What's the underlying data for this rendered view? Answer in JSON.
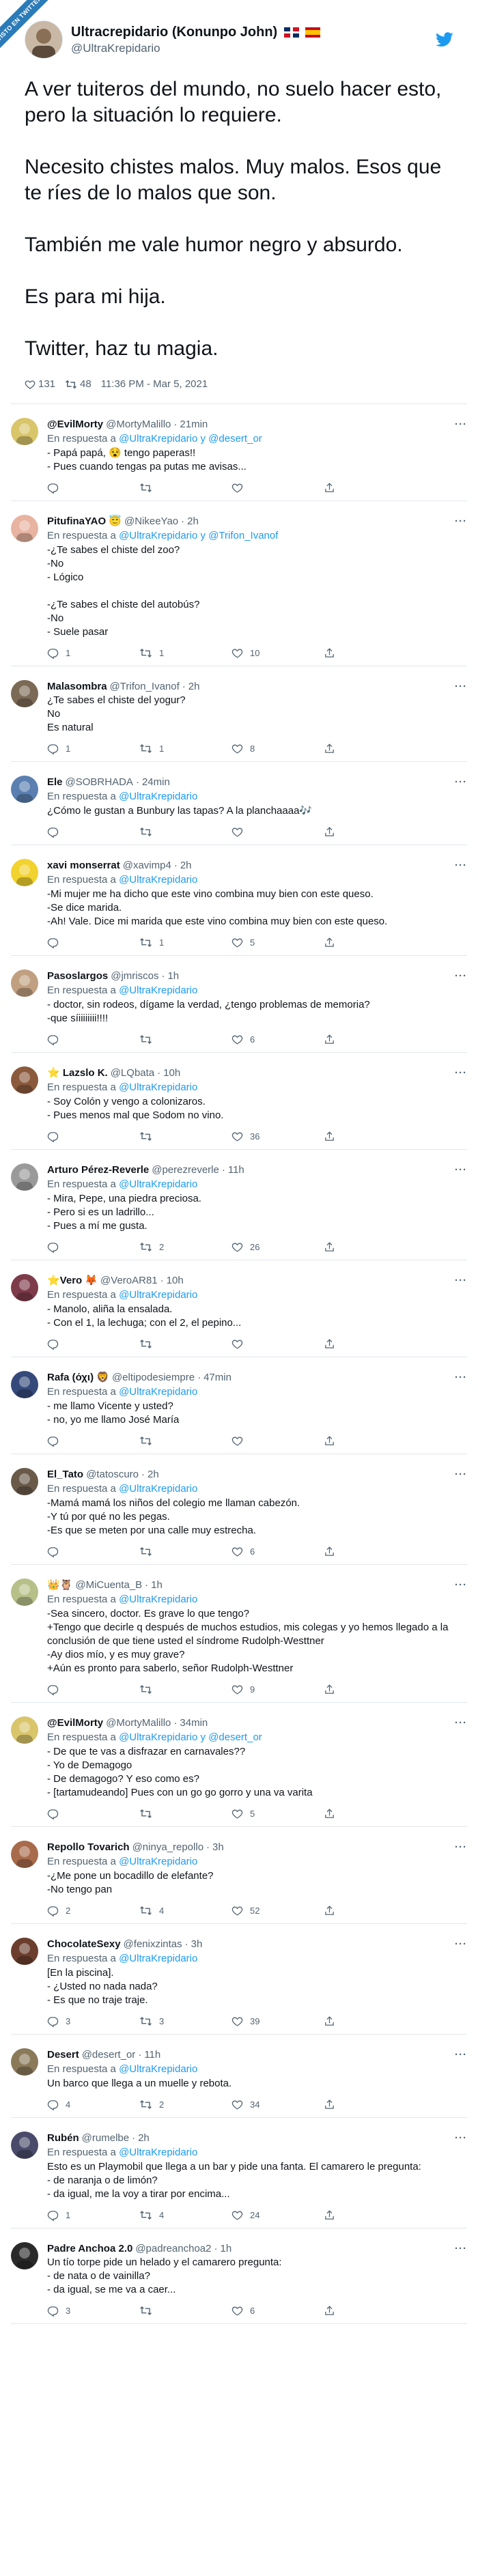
{
  "ribbon": "VISTO EN TWITTER",
  "main": {
    "name": "Ultracrepidario (Konunpo John)",
    "handle": "@UltraKrepidario",
    "paragraphs": [
      "A ver tuiteros del mundo, no suelo hacer esto, pero la situación lo requiere.",
      "Necesito chistes malos. Muy malos. Esos que te ríes de lo malos que son.",
      "También me vale humor negro y absurdo.",
      "Es para mi hija.",
      "Twitter, haz tu magia."
    ],
    "likes": "131",
    "retweets": "48",
    "timestamp": "11:36 PM - Mar 5, 2021"
  },
  "icons": {
    "more": "more-icon",
    "reply": "reply-icon",
    "retweet": "retweet-icon",
    "like": "like-icon",
    "share": "share-icon",
    "twitter": "twitter-bird-icon"
  },
  "in_reply_prefix": "En respuesta a",
  "replies": [
    {
      "name": "@EvilMorty",
      "handle": "@MortyMalillo",
      "time": "21min",
      "to": "@UltraKrepidario y @desert_or",
      "text": "- Papá papá, 😵 tengo paperas!!\n- Pues cuando tengas pa putas me avisas...",
      "reply": "",
      "rt": "",
      "like": ""
    },
    {
      "name": "PitufinaYAO 😇",
      "handle": "@NikeeYao",
      "time": "2h",
      "to": "@UltraKrepidario y @Trifon_Ivanof",
      "text": "-¿Te sabes el chiste del zoo?\n-No\n- Lógico\n\n-¿Te sabes el chiste del autobús?\n-No\n- Suele pasar",
      "reply": "1",
      "rt": "1",
      "like": "10"
    },
    {
      "name": "Malasombra",
      "handle": "@Trifon_Ivanof",
      "time": "2h",
      "to": "",
      "text": "¿Te sabes el chiste del yogur?\nNo\nEs natural",
      "reply": "1",
      "rt": "1",
      "like": "8"
    },
    {
      "name": "Ele",
      "handle": "@SOBRHADA",
      "time": "24min",
      "to": "@UltraKrepidario",
      "text": "¿Cómo le gustan a Bunbury las tapas? A la planchaaaa🎶",
      "reply": "",
      "rt": "",
      "like": ""
    },
    {
      "name": "xavi monserrat",
      "handle": "@xavimp4",
      "time": "2h",
      "to": "@UltraKrepidario",
      "text": "-Mi mujer me ha dicho que este vino combina muy bien con este queso.\n-Se dice marida.\n-Ah! Vale. Dice mi marida que este vino combina muy bien con este queso.",
      "reply": "",
      "rt": "1",
      "like": "5"
    },
    {
      "name": "Pasoslargos",
      "handle": "@jmriscos",
      "time": "1h",
      "to": "@UltraKrepidario",
      "text": "- doctor, sin rodeos, dígame la verdad, ¿tengo problemas de memoria?\n-que síiiiiiiii!!!!",
      "reply": "",
      "rt": "",
      "like": "6"
    },
    {
      "name": "⭐ Lazslo K.",
      "handle": "@LQbata",
      "time": "10h",
      "to": "@UltraKrepidario",
      "text": "- Soy Colón y vengo a colonizaros.\n- Pues menos mal que Sodom no vino.",
      "reply": "",
      "rt": "",
      "like": "36"
    },
    {
      "name": "Arturo Pérez-Reverle",
      "handle": "@perezreverle",
      "time": "11h",
      "to": "@UltraKrepidario",
      "text": "- Mira, Pepe, una piedra preciosa.\n- Pero si es un ladrillo...\n- Pues a mí me gusta.",
      "reply": "",
      "rt": "2",
      "like": "26"
    },
    {
      "name": "⭐Vero 🦊",
      "handle": "@VeroAR81",
      "time": "10h",
      "to": "@UltraKrepidario",
      "text": "- Manolo, aliña la ensalada.\n- Con el 1, la lechuga; con el 2, el pepino...",
      "reply": "",
      "rt": "",
      "like": ""
    },
    {
      "name": "Rafa (όχι) 🦁",
      "handle": "@eltipodesiempre",
      "time": "47min",
      "to": "@UltraKrepidario",
      "text": "- me llamo Vicente y usted?\n- no, yo me llamo José María",
      "reply": "",
      "rt": "",
      "like": ""
    },
    {
      "name": "El_Tato",
      "handle": "@tatoscuro",
      "time": "2h",
      "to": "@UltraKrepidario",
      "text": "-Mamá mamá los niños del colegio me llaman cabezón.\n-Y tú por qué no les pegas.\n-Es que se meten por una calle muy estrecha.",
      "reply": "",
      "rt": "",
      "like": "6"
    },
    {
      "name": "👑🦉",
      "handle": "@MiCuenta_B",
      "time": "1h",
      "to": "@UltraKrepidario",
      "text": "-Sea sincero, doctor. Es grave lo que tengo?\n+Tengo que decirle q después de muchos estudios, mis colegas y yo hemos llegado a la conclusión de que tiene usted el síndrome Rudolph-Westtner\n-Ay dios mío, y es muy grave?\n+Aún es pronto para saberlo, señor Rudolph-Westtner",
      "reply": "",
      "rt": "",
      "like": "9"
    },
    {
      "name": "@EvilMorty",
      "handle": "@MortyMalillo",
      "time": "34min",
      "to": "@UltraKrepidario y @desert_or",
      "text": "- De que te vas a disfrazar en carnavales??\n- Yo de Demagogo\n- De demagogo? Y eso como es?\n- [tartamudeando] Pues con un go go gorro y una va varita",
      "reply": "",
      "rt": "",
      "like": "5"
    },
    {
      "name": "Repollo Tovarich",
      "handle": "@ninya_repollo",
      "time": "3h",
      "to": "@UltraKrepidario",
      "text": "-¿Me pone un bocadillo de elefante?\n-No tengo pan",
      "reply": "2",
      "rt": "4",
      "like": "52"
    },
    {
      "name": "ChocolateSexy",
      "handle": "@fenixzintas",
      "time": "3h",
      "to": "@UltraKrepidario",
      "text": "[En la piscina].\n- ¿Usted no nada nada?\n- Es que no traje traje.",
      "reply": "3",
      "rt": "3",
      "like": "39"
    },
    {
      "name": "Desert",
      "handle": "@desert_or",
      "time": "11h",
      "to": "@UltraKrepidario",
      "text": "Un barco que llega a un muelle y rebota.",
      "reply": "4",
      "rt": "2",
      "like": "34"
    },
    {
      "name": "Rubén",
      "handle": "@rumelbe",
      "time": "2h",
      "to": "@UltraKrepidario",
      "text": "Esto es un Playmobil que llega a un bar y pide una fanta. El camarero le pregunta:\n- de naranja o de limón?\n- da igual, me la voy a tirar por encima...",
      "reply": "1",
      "rt": "4",
      "like": "24"
    },
    {
      "name": "Padre Anchoa 2.0",
      "handle": "@padreanchoa2",
      "time": "1h",
      "to": "",
      "text": "Un tío torpe pide un helado y el camarero pregunta:\n- de nata o de vainilla?\n- da igual, se me va a caer...",
      "reply": "3",
      "rt": "",
      "like": "6"
    }
  ],
  "colors": {
    "link": "#1d9bf0",
    "muted": "#536471",
    "twitter_blue": "#1d9bf0"
  }
}
